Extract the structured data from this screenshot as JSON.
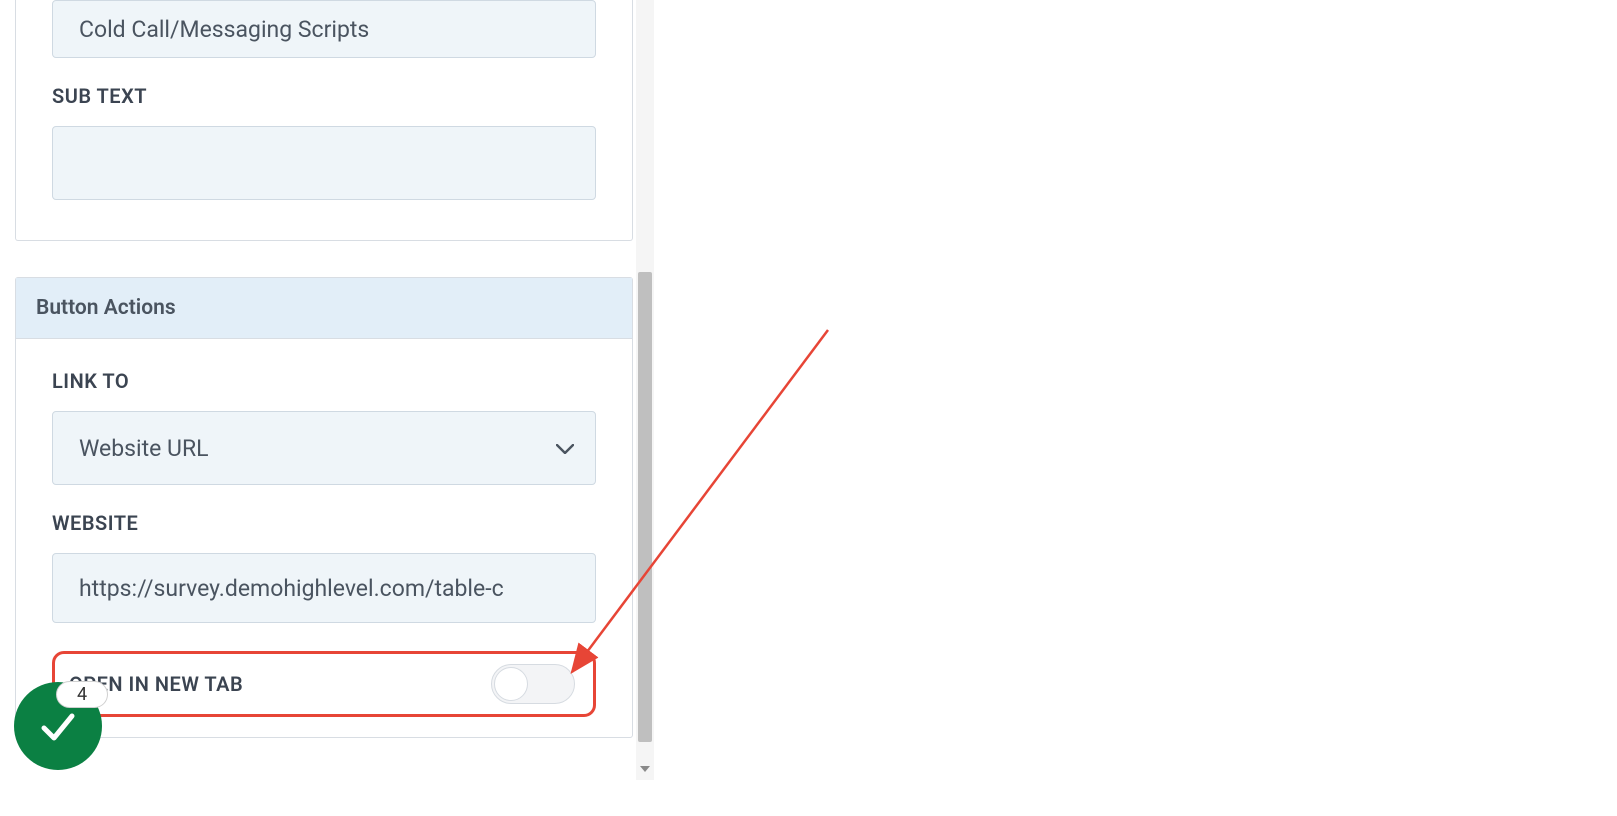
{
  "topField": {
    "value": "Cold Call/Messaging Scripts"
  },
  "subText": {
    "label": "SUB TEXT",
    "value": ""
  },
  "buttonActions": {
    "header": "Button Actions",
    "linkTo": {
      "label": "LINK TO",
      "selected": "Website URL"
    },
    "website": {
      "label": "WEBSITE",
      "value": "https://survey.demohighlevel.com/table-c"
    },
    "openNewTab": {
      "label": "OPEN IN NEW TAB",
      "on": false
    }
  },
  "stepBadge": "4"
}
